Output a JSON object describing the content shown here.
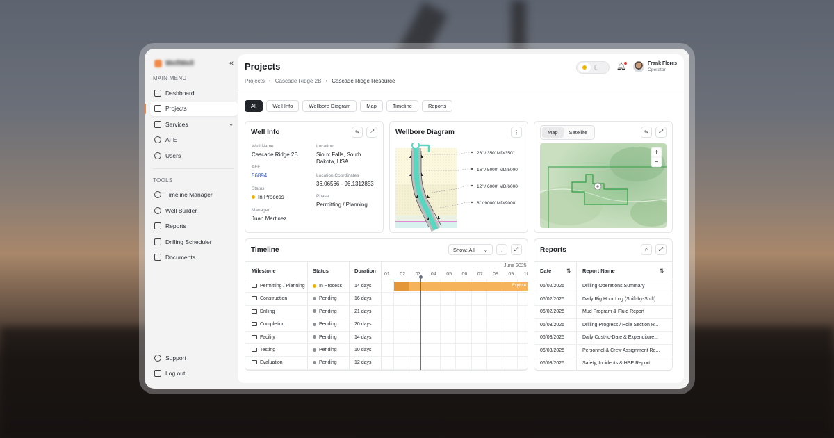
{
  "sidebar": {
    "brand": "WellWell",
    "collapse_icon": "«",
    "main_menu_label": "MAIN MENU",
    "main_items": [
      {
        "label": "Dashboard",
        "icon": "dashboard-icon"
      },
      {
        "label": "Projects",
        "icon": "folder-icon",
        "active": true
      },
      {
        "label": "Services",
        "icon": "box-icon",
        "has_submenu": true
      },
      {
        "label": "AFE",
        "icon": "dollar-icon"
      },
      {
        "label": "Users",
        "icon": "users-icon"
      }
    ],
    "tools_label": "TOOLS",
    "tool_items": [
      {
        "label": "Timeline Manager",
        "icon": "clock-icon"
      },
      {
        "label": "Well Builder",
        "icon": "target-icon"
      },
      {
        "label": "Reports",
        "icon": "chart-line-icon"
      },
      {
        "label": "Drilling Scheduler",
        "icon": "calendar-icon"
      },
      {
        "label": "Documents",
        "icon": "document-icon"
      }
    ],
    "bottom_items": [
      {
        "label": "Support",
        "icon": "help-icon"
      },
      {
        "label": "Log out",
        "icon": "logout-icon"
      }
    ]
  },
  "header": {
    "title": "Projects",
    "breadcrumb": [
      "Projects",
      "Cascade Ridge 2B",
      "Cascade Ridge Resource"
    ],
    "user": {
      "name": "Frank Flores",
      "role": "Operator"
    }
  },
  "filters": [
    "All",
    "Well Info",
    "Wellbore Diagram",
    "Map",
    "Timeline",
    "Reports"
  ],
  "active_filter": "All",
  "well_info": {
    "title": "Well Info",
    "well_name_label": "Well Name",
    "well_name": "Cascade Ridge 2B",
    "afe_label": "AFE",
    "afe": "56894",
    "status_label": "Status",
    "status": "In Process",
    "manager_label": "Manager",
    "manager": "Juan Martinez",
    "location_label": "Location",
    "location_line1": "Sioux Falls, South",
    "location_line2": "Dakota, USA",
    "coords_label": "Location Coordinates",
    "coords": "36.06566 - 96.1312853",
    "phase_label": "Phase",
    "phase": "Permitting / Planning"
  },
  "wellbore": {
    "title": "Wellbore Diagram",
    "casings": [
      "26\" / 350' MD/350'",
      "16\" / 5000' MD/5000'",
      "12\" / 6000' MD/6000'",
      "8\" / 9000' MD/9000'"
    ]
  },
  "map": {
    "tabs": [
      "Map",
      "Satellite"
    ],
    "active_tab": "Map",
    "zoom_in": "+",
    "zoom_out": "−"
  },
  "timeline": {
    "title": "Timeline",
    "show_label": "Show: All",
    "headers": {
      "milestone": "Milestone",
      "status": "Status",
      "duration": "Duration"
    },
    "month": "June 2025",
    "days": [
      "01",
      "02",
      "03",
      "04",
      "05",
      "06",
      "07",
      "08",
      "09",
      "10"
    ],
    "current_day": "03",
    "bar_label": "Explore",
    "rows": [
      {
        "milestone": "Permitting / Planning",
        "status": "In Process",
        "duration": "14 days"
      },
      {
        "milestone": "Construction",
        "status": "Pending",
        "duration": "16 days"
      },
      {
        "milestone": "Drilling",
        "status": "Pending",
        "duration": "21 days"
      },
      {
        "milestone": "Completion",
        "status": "Pending",
        "duration": "20 days"
      },
      {
        "milestone": "Facility",
        "status": "Pending",
        "duration": "14 days"
      },
      {
        "milestone": "Testing",
        "status": "Pending",
        "duration": "10 days"
      },
      {
        "milestone": "Evaluation",
        "status": "Pending",
        "duration": "12 days"
      }
    ]
  },
  "reports": {
    "title": "Reports",
    "headers": {
      "date": "Date",
      "name": "Report Name"
    },
    "rows": [
      {
        "date": "06/02/2025",
        "name": "Drilling Operations Summary"
      },
      {
        "date": "06/02/2025",
        "name": "Daily Rig Hour Log (Shift-by-Shift)"
      },
      {
        "date": "06/02/2025",
        "name": "Mud Program & Fluid Report"
      },
      {
        "date": "06/03/2025",
        "name": "Drilling Progress / Hole Section R..."
      },
      {
        "date": "06/03/2025",
        "name": "Daily Cost-to-Date & Expenditure..."
      },
      {
        "date": "06/03/2025",
        "name": "Personnel & Crew Assignment Re..."
      },
      {
        "date": "06/03/2025",
        "name": "Safety, Incidents & HSE Report"
      }
    ]
  },
  "colors": {
    "accent": "#f08a4b",
    "in_process": "#f5b400",
    "pending": "#8a8f96",
    "gantt_bar": "#f5b35c",
    "gantt_done": "#e3963a",
    "today_line": "#5b6fa8",
    "wellbore_fluid": "#57d6c0"
  }
}
